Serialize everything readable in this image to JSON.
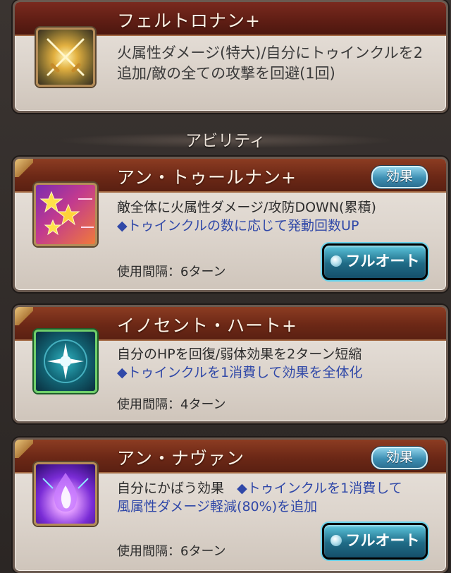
{
  "support": {
    "title": "フェルトロナン+",
    "desc": "火属性ダメージ(特大)/自分にトゥインクルを2追加/敵の全ての攻撃を回避(1回)",
    "icon": "crossed-swords-icon"
  },
  "section_title": "アビリティ",
  "abilities": [
    {
      "title": "アン・トゥールナン+",
      "effect_label": "効果",
      "desc": "敵全体に火属性ダメージ/攻防DOWN(累積)",
      "desc_blue": "◆トゥインクルの数に応じて発動回数UP",
      "interval": "使用間隔：6ターン",
      "auto_label": "フルオート",
      "icon": "stars-icon"
    },
    {
      "title": "イノセント・ハート+",
      "desc": "自分のHPを回復/弱体効果を2ターン短縮",
      "desc_blue": "◆トゥインクルを1消費して効果を全体化",
      "interval": "使用間隔：4ターン",
      "icon": "sparkle-icon"
    },
    {
      "title": "アン・ナヴァン",
      "effect_label": "効果",
      "desc": "自分にかばう効果",
      "desc_blue": "◆トゥインクルを1消費して",
      "desc_blue2": "風属性ダメージ軽減(80%)を追加",
      "interval": "使用間隔：6ターン",
      "auto_label": "フルオート",
      "icon": "purple-flame-icon"
    }
  ],
  "colors": {
    "header_brown": "#6c2816",
    "accent_blue": "#3048a8",
    "button_teal": "#1f6b86"
  }
}
